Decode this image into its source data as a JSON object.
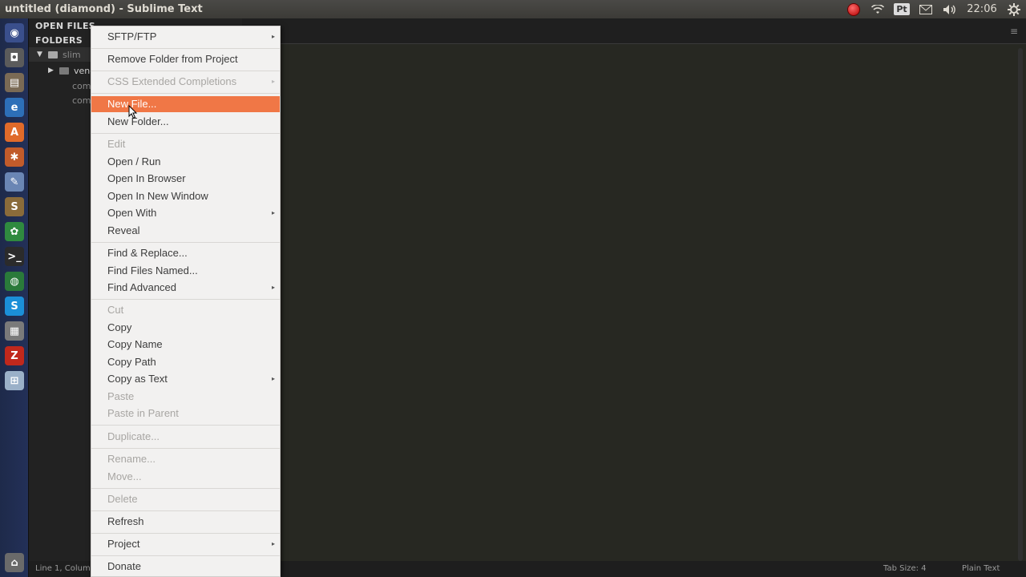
{
  "window": {
    "title": "untitled (diamond) - Sublime Text"
  },
  "tray": {
    "indicator": "Pt",
    "clock": "22:06"
  },
  "sidebar": {
    "open_files_header": "OPEN FILES",
    "folders_header": "FOLDERS",
    "tree": [
      {
        "label": "slim"
      },
      {
        "label": "vend"
      },
      {
        "label": "com"
      },
      {
        "label": "com"
      }
    ]
  },
  "statusbar": {
    "position": "Line 1, Colum",
    "tab_size": "Tab Size: 4",
    "syntax": "Plain Text"
  },
  "context_menu": {
    "items": [
      {
        "label": "SFTP/FTP",
        "submenu": true,
        "enabled": true
      },
      {
        "label": "Remove Folder from Project",
        "enabled": true
      },
      {
        "label": "CSS Extended Completions",
        "submenu": true,
        "enabled": false
      },
      {
        "label": "New File...",
        "enabled": true,
        "highlighted": true
      },
      {
        "label": "New Folder...",
        "enabled": true
      },
      {
        "label": "Edit",
        "enabled": false
      },
      {
        "label": "Open / Run",
        "enabled": true
      },
      {
        "label": "Open In Browser",
        "enabled": true
      },
      {
        "label": "Open In New Window",
        "enabled": true
      },
      {
        "label": "Open With",
        "submenu": true,
        "enabled": true
      },
      {
        "label": "Reveal",
        "enabled": true
      },
      {
        "label": "Find & Replace...",
        "enabled": true
      },
      {
        "label": "Find Files Named...",
        "enabled": true
      },
      {
        "label": "Find Advanced",
        "submenu": true,
        "enabled": true
      },
      {
        "label": "Cut",
        "enabled": false
      },
      {
        "label": "Copy",
        "enabled": true
      },
      {
        "label": "Copy Name",
        "enabled": true
      },
      {
        "label": "Copy Path",
        "enabled": true
      },
      {
        "label": "Copy as Text",
        "submenu": true,
        "enabled": true
      },
      {
        "label": "Paste",
        "enabled": false
      },
      {
        "label": "Paste in Parent",
        "enabled": false
      },
      {
        "label": "Duplicate...",
        "enabled": false
      },
      {
        "label": "Rename...",
        "enabled": false
      },
      {
        "label": "Move...",
        "enabled": false
      },
      {
        "label": "Delete",
        "enabled": false
      },
      {
        "label": "Refresh",
        "enabled": true
      },
      {
        "label": "Project",
        "submenu": true,
        "enabled": true
      },
      {
        "label": "Donate",
        "enabled": true
      }
    ]
  },
  "colors": {
    "menu_highlight": "#f07746",
    "editor_bg": "#272822",
    "launcher_bg": "#233058"
  }
}
